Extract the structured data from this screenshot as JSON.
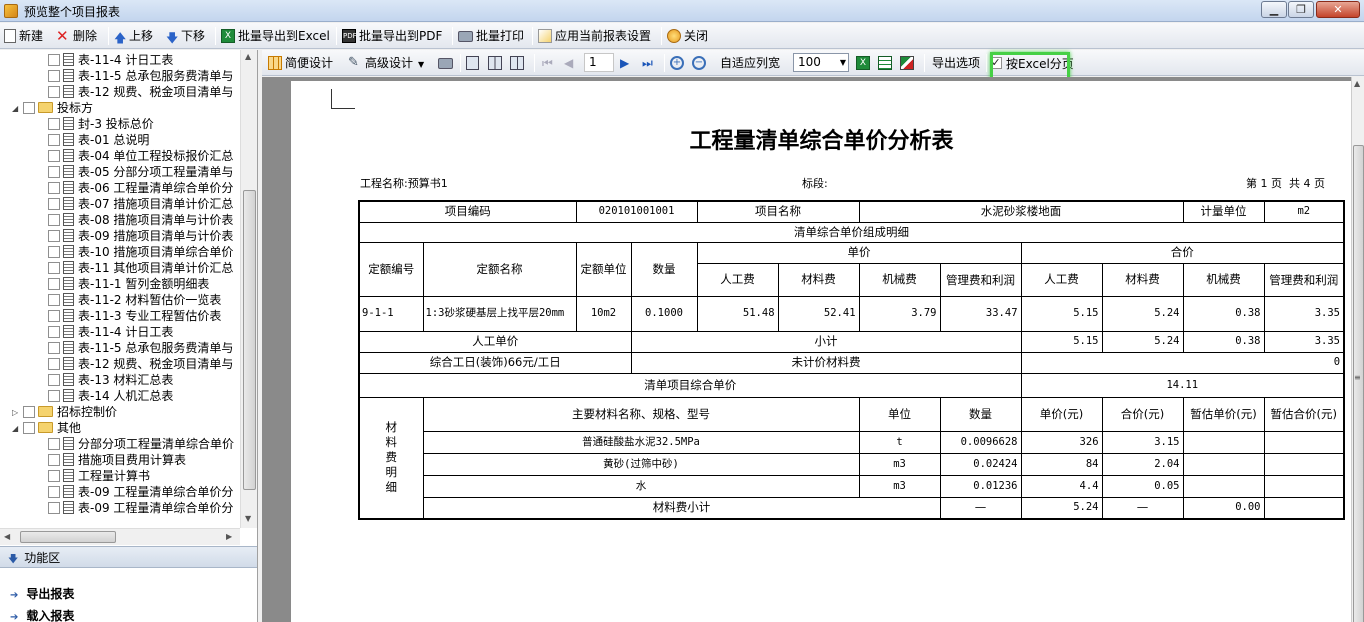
{
  "window": {
    "title": "预览整个项目报表"
  },
  "toolbar": {
    "new": "新建",
    "delete": "删除",
    "up": "上移",
    "down": "下移",
    "export_excel": "批量导出到Excel",
    "export_pdf": "批量导出到PDF",
    "print": "批量打印",
    "apply": "应用当前报表设置",
    "close": "关闭"
  },
  "tree": [
    {
      "label": "表-11-4 计日工表",
      "type": "doc",
      "level": 2
    },
    {
      "label": "表-11-5 总承包服务费清单与",
      "type": "doc",
      "level": 2
    },
    {
      "label": "表-12 规费、税金项目清单与",
      "type": "doc",
      "level": 2
    },
    {
      "label": "投标方",
      "type": "folder",
      "level": 1,
      "exp": "◢"
    },
    {
      "label": "封-3 投标总价",
      "type": "doc",
      "level": 2
    },
    {
      "label": "表-01 总说明",
      "type": "doc",
      "level": 2
    },
    {
      "label": "表-04 单位工程投标报价汇总",
      "type": "doc",
      "level": 2
    },
    {
      "label": "表-05 分部分项工程量清单与",
      "type": "doc",
      "level": 2
    },
    {
      "label": "表-06 工程量清单综合单价分",
      "type": "doc",
      "level": 2
    },
    {
      "label": "表-07 措施项目清单计价汇总",
      "type": "doc",
      "level": 2
    },
    {
      "label": "表-08 措施项目清单与计价表",
      "type": "doc",
      "level": 2
    },
    {
      "label": "表-09 措施项目清单与计价表",
      "type": "doc",
      "level": 2
    },
    {
      "label": "表-10 措施项目清单综合单价",
      "type": "doc",
      "level": 2
    },
    {
      "label": "表-11 其他项目清单计价汇总",
      "type": "doc",
      "level": 2
    },
    {
      "label": "表-11-1 暂列金额明细表",
      "type": "doc",
      "level": 2
    },
    {
      "label": "表-11-2 材料暂估价一览表",
      "type": "doc",
      "level": 2
    },
    {
      "label": "表-11-3 专业工程暂估价表",
      "type": "doc",
      "level": 2
    },
    {
      "label": "表-11-4 计日工表",
      "type": "doc",
      "level": 2
    },
    {
      "label": "表-11-5 总承包服务费清单与",
      "type": "doc",
      "level": 2
    },
    {
      "label": "表-12 规费、税金项目清单与",
      "type": "doc",
      "level": 2
    },
    {
      "label": "表-13 材料汇总表",
      "type": "doc",
      "level": 2
    },
    {
      "label": "表-14 人机汇总表",
      "type": "doc",
      "level": 2
    },
    {
      "label": "招标控制价",
      "type": "folder",
      "level": 1,
      "exp": "▷"
    },
    {
      "label": "其他",
      "type": "folder",
      "level": 1,
      "exp": "◢"
    },
    {
      "label": "分部分项工程量清单综合单价",
      "type": "doc",
      "level": 2
    },
    {
      "label": "措施项目费用计算表",
      "type": "doc",
      "level": 2
    },
    {
      "label": "工程量计算书",
      "type": "doc",
      "level": 2
    },
    {
      "label": "表-09 工程量清单综合单价分",
      "type": "doc",
      "level": 2
    },
    {
      "label": "表-09 工程量清单综合单价分",
      "type": "doc",
      "level": 2
    }
  ],
  "panel": {
    "func_area": "功能区",
    "export_report": "导出报表",
    "load_report": "载入报表"
  },
  "viewer_toolbar": {
    "simple_design": "简便设计",
    "advanced_design": "高级设计",
    "page_number": "1",
    "auto_fit": "自适应列宽",
    "zoom": "100",
    "export_options": "导出选项",
    "excel_paging": "按Excel分页",
    "excel_paging_checked": true
  },
  "report": {
    "title": "工程量清单综合单价分析表",
    "project_name_label": "工程名称:预算书1",
    "section_label": "标段:",
    "page_info": "第 1 页  共 4 页",
    "h_item_code": "项目编码",
    "item_code": "020101001001",
    "h_item_name": "项目名称",
    "item_name": "水泥砂浆楼地面",
    "h_unit": "计量单位",
    "unit": "m2",
    "h_breakdown": "清单综合单价组成明细",
    "h_quota_code": "定额编号",
    "h_quota_name": "定额名称",
    "h_quota_unit": "定额单位",
    "h_qty": "数量",
    "h_unit_price": "单价",
    "h_total_price": "合价",
    "h_labor": "人工费",
    "h_material": "材料费",
    "h_machine": "机械费",
    "h_mgmt": "管理费和利润",
    "row": {
      "code": "9-1-1",
      "name": "1:3砂浆硬基层上找平层20mm",
      "unit": "10m2",
      "qty": "0.1000",
      "u_labor": "51.48",
      "u_material": "52.41",
      "u_machine": "3.79",
      "u_mgmt": "33.47",
      "t_labor": "5.15",
      "t_material": "5.24",
      "t_machine": "0.38",
      "t_mgmt": "3.35"
    },
    "labor_unit_price": "人工单价",
    "subtotal": "小计",
    "sub_labor": "5.15",
    "sub_material": "5.24",
    "sub_machine": "0.38",
    "sub_mgmt": "3.35",
    "workday": "综合工日(装饰)66元/工日",
    "unpriced_material": "未计价材料费",
    "unpriced_value": "0",
    "item_unit_price_label": "清单项目综合单价",
    "item_unit_price": "14.11",
    "mat_side": "材料费明细",
    "h_mat_name": "主要材料名称、规格、型号",
    "h_mat_unit": "单位",
    "h_mat_qty": "数量",
    "h_mat_price": "单价(元)",
    "h_mat_total": "合价(元)",
    "h_est_price": "暂估单价(元)",
    "h_est_total": "暂估合价(元)",
    "materials": [
      {
        "name": "普通硅酸盐水泥32.5MPa",
        "unit": "t",
        "qty": "0.0096628",
        "price": "326",
        "total": "3.15"
      },
      {
        "name": "黄砂(过筛中砂)",
        "unit": "m3",
        "qty": "0.02424",
        "price": "84",
        "total": "2.04"
      },
      {
        "name": "水",
        "unit": "m3",
        "qty": "0.01236",
        "price": "4.4",
        "total": "0.05"
      }
    ],
    "mat_subtotal_label": "材料费小计",
    "mat_sub_price": "—",
    "mat_sub_total": "5.24",
    "mat_sub_est_price": "—",
    "mat_sub_est_total": "0.00"
  }
}
